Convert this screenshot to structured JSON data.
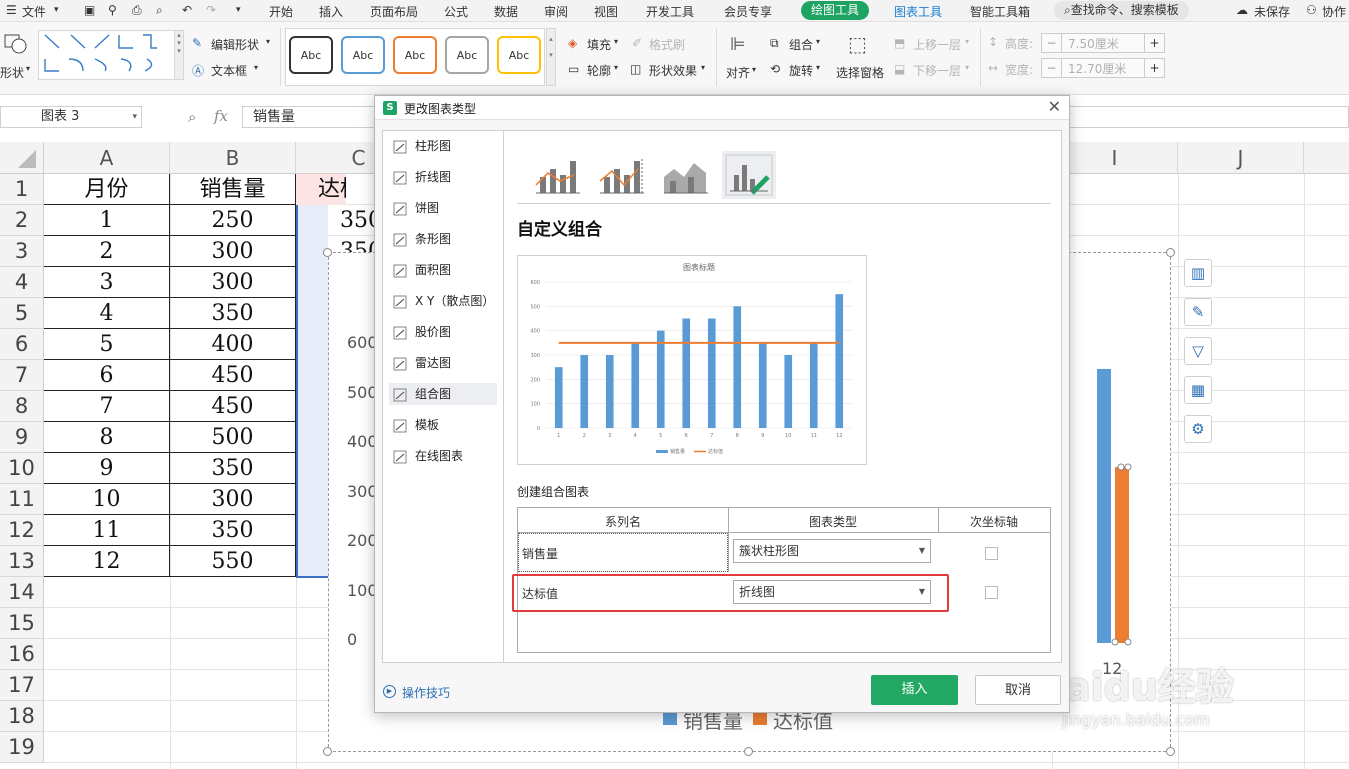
{
  "menubar": {
    "file": "文件",
    "start": "开始",
    "insert": "插入",
    "page_layout": "页面布局",
    "formula": "公式",
    "data": "数据",
    "review": "审阅",
    "view": "视图",
    "developer": "开发工具",
    "member": "会员专享",
    "drawing_tools": "绘图工具",
    "chart_tools": "图表工具",
    "smart_toolbox": "智能工具箱",
    "search": "查找命令、搜索模板",
    "unsaved": "未保存",
    "collab": "协作"
  },
  "ribbon": {
    "shape": "形状",
    "edit_shape": "编辑形状",
    "textbox": "文本框",
    "abc": "Abc",
    "fill": "填充",
    "format_brush": "格式刷",
    "outline": "轮廓",
    "shape_effect": "形状效果",
    "align": "对齐",
    "group": "组合",
    "rotate": "旋转",
    "selection_pane": "选择窗格",
    "bring_forward": "上移一层",
    "send_backward": "下移一层",
    "height_label": "高度:",
    "height_value": "7.50厘米",
    "width_label": "宽度:",
    "width_value": "12.70厘米",
    "plus": "+",
    "minus": "−"
  },
  "formula_bar": {
    "name_box": "图表 3",
    "fx": "fx",
    "content": "销售量"
  },
  "sheet": {
    "columns": [
      "A",
      "B",
      "C",
      "I",
      "J"
    ],
    "row_numbers": [
      "1",
      "2",
      "3",
      "4",
      "5",
      "6",
      "7",
      "8",
      "9",
      "10",
      "11",
      "12",
      "13",
      "14",
      "15",
      "16",
      "17",
      "18",
      "19"
    ],
    "header_a": "月份",
    "header_b": "销售量",
    "header_c": "达标",
    "months": [
      "1",
      "2",
      "3",
      "4",
      "5",
      "6",
      "7",
      "8",
      "9",
      "10",
      "11",
      "12"
    ],
    "sales": [
      "250",
      "300",
      "300",
      "350",
      "400",
      "450",
      "450",
      "500",
      "350",
      "300",
      "350",
      "550"
    ],
    "c2": "350",
    "c3": "350"
  },
  "bg_chart": {
    "y_ticks": [
      "600",
      "500",
      "400",
      "300",
      "200",
      "100",
      "0"
    ],
    "x_label": "12",
    "legend_sales": "销售量",
    "legend_target": "达标值"
  },
  "dialog": {
    "title": "更改图表类型",
    "nav": [
      "柱形图",
      "折线图",
      "饼图",
      "条形图",
      "面积图",
      "X Y（散点图）",
      "股价图",
      "雷达图",
      "组合图",
      "模板",
      "在线图表"
    ],
    "section_title": "自定义组合",
    "create_label": "创建组合图表",
    "col_series": "系列名",
    "col_type": "图表类型",
    "col_secondary": "次坐标轴",
    "rows": [
      {
        "name": "销售量",
        "type": "簇状柱形图"
      },
      {
        "name": "达标值",
        "type": "折线图"
      }
    ],
    "tips": "操作技巧",
    "insert": "插入",
    "cancel": "取消"
  },
  "chart_data": {
    "type": "bar",
    "title": "图表标题",
    "categories": [
      "1",
      "2",
      "3",
      "4",
      "5",
      "6",
      "7",
      "8",
      "9",
      "10",
      "11",
      "12"
    ],
    "series": [
      {
        "name": "销售量",
        "type": "bar",
        "values": [
          250,
          300,
          300,
          350,
          400,
          450,
          450,
          500,
          350,
          300,
          350,
          550
        ]
      },
      {
        "name": "达标值",
        "type": "line",
        "values": [
          350,
          350,
          350,
          350,
          350,
          350,
          350,
          350,
          350,
          350,
          350,
          350
        ]
      }
    ],
    "y_ticks": [
      "0",
      "100",
      "200",
      "300",
      "400",
      "500",
      "600"
    ],
    "ylim": [
      0,
      600
    ],
    "grid": true,
    "legend": "bottom",
    "colors": {
      "sales": "#5b9bd5",
      "target": "#ed7d31"
    }
  },
  "colors": {
    "accent_green": "#1ea362",
    "blue": "#1a7fd4",
    "highlight": "#e23b3b"
  },
  "watermark": {
    "brand": "Baidu经验",
    "url": "jingyan.baidu.com"
  }
}
